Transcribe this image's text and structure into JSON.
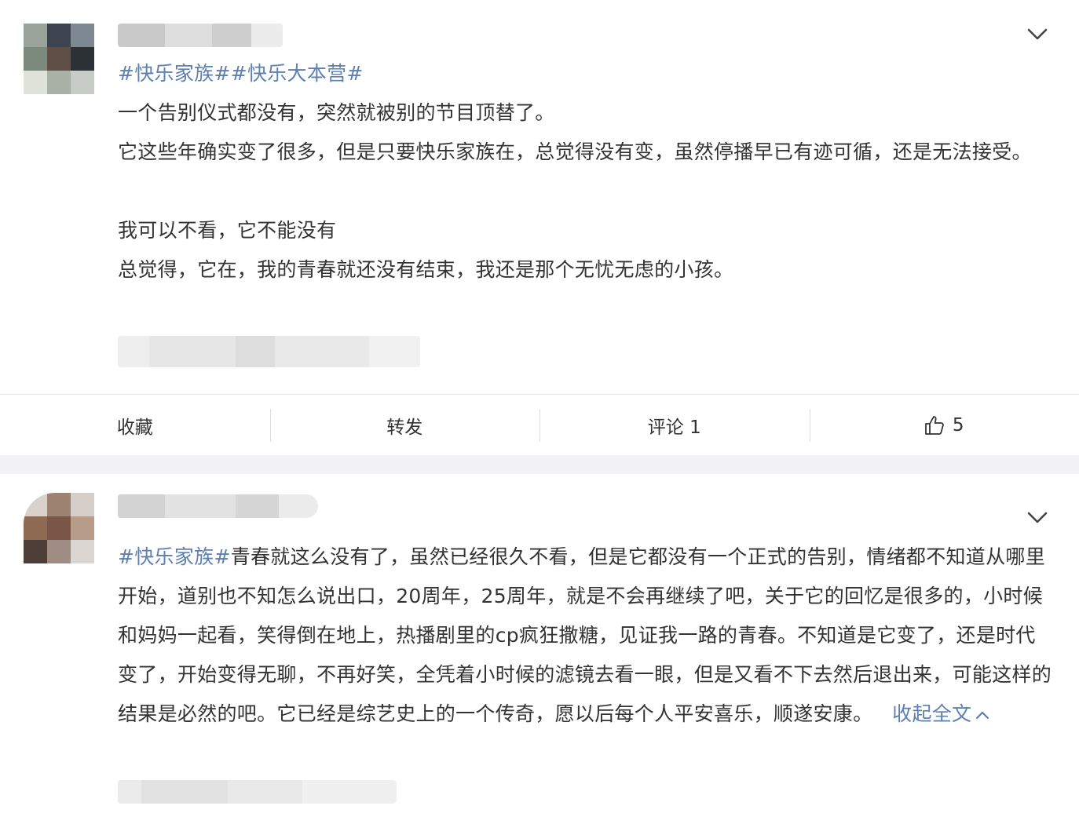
{
  "posts": [
    {
      "tags": "#快乐家族##快乐大本营#",
      "paragraphs": [
        "一个告别仪式都没有，突然就被别的节目顶替了。",
        "它这些年确实变了很多，但是只要快乐家族在，总觉得没有变，虽然停播早已有迹可循，还是无法接受。",
        "",
        "我可以不看，它不能没有",
        "总觉得，它在，我的青春就还没有结束，我还是那个无忧无虑的小孩。"
      ],
      "actions": {
        "favorite": "收藏",
        "repost": "转发",
        "comment": "评论 1",
        "like": "5"
      }
    },
    {
      "tag": "#快乐家族#",
      "body": "青春就这么没有了，虽然已经很久不看，但是它都没有一个正式的告别，情绪都不知道从哪里开始，道别也不知怎么说出口，20周年，25周年，就是不会再继续了吧，关于它的回忆是很多的，小时候和妈妈一起看，笑得倒在地上，热播剧里的cp疯狂撒糖，见证我一路的青春。不知道是它变了，还是时代变了，开始变得无聊，不再好笑，全凭着小时候的滤镜去看一眼，但是又看不下去然后退出来，可能这样的结果是必然的吧。它已经是综艺史上的一个传奇，愿以后每个人平安喜乐，顺遂安康。",
      "collapse_label": "收起全文"
    }
  ],
  "icons": {
    "menu": "chevron-down-icon",
    "like": "thumbs-up-icon",
    "collapse": "chevron-up-icon"
  },
  "colors": {
    "link": "#5d7fb2",
    "text": "#333333",
    "divider": "#e6e6e6",
    "background": "#f2f2f5"
  }
}
